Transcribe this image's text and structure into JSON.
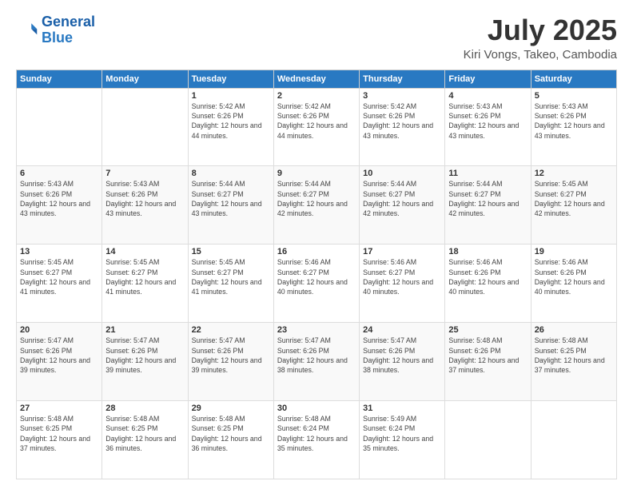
{
  "logo": {
    "line1": "General",
    "line2": "Blue"
  },
  "header": {
    "month_year": "July 2025",
    "location": "Kiri Vongs, Takeo, Cambodia"
  },
  "days_of_week": [
    "Sunday",
    "Monday",
    "Tuesday",
    "Wednesday",
    "Thursday",
    "Friday",
    "Saturday"
  ],
  "weeks": [
    [
      {
        "day": "",
        "info": ""
      },
      {
        "day": "",
        "info": ""
      },
      {
        "day": "1",
        "info": "Sunrise: 5:42 AM\nSunset: 6:26 PM\nDaylight: 12 hours and 44 minutes."
      },
      {
        "day": "2",
        "info": "Sunrise: 5:42 AM\nSunset: 6:26 PM\nDaylight: 12 hours and 44 minutes."
      },
      {
        "day": "3",
        "info": "Sunrise: 5:42 AM\nSunset: 6:26 PM\nDaylight: 12 hours and 43 minutes."
      },
      {
        "day": "4",
        "info": "Sunrise: 5:43 AM\nSunset: 6:26 PM\nDaylight: 12 hours and 43 minutes."
      },
      {
        "day": "5",
        "info": "Sunrise: 5:43 AM\nSunset: 6:26 PM\nDaylight: 12 hours and 43 minutes."
      }
    ],
    [
      {
        "day": "6",
        "info": "Sunrise: 5:43 AM\nSunset: 6:26 PM\nDaylight: 12 hours and 43 minutes."
      },
      {
        "day": "7",
        "info": "Sunrise: 5:43 AM\nSunset: 6:26 PM\nDaylight: 12 hours and 43 minutes."
      },
      {
        "day": "8",
        "info": "Sunrise: 5:44 AM\nSunset: 6:27 PM\nDaylight: 12 hours and 43 minutes."
      },
      {
        "day": "9",
        "info": "Sunrise: 5:44 AM\nSunset: 6:27 PM\nDaylight: 12 hours and 42 minutes."
      },
      {
        "day": "10",
        "info": "Sunrise: 5:44 AM\nSunset: 6:27 PM\nDaylight: 12 hours and 42 minutes."
      },
      {
        "day": "11",
        "info": "Sunrise: 5:44 AM\nSunset: 6:27 PM\nDaylight: 12 hours and 42 minutes."
      },
      {
        "day": "12",
        "info": "Sunrise: 5:45 AM\nSunset: 6:27 PM\nDaylight: 12 hours and 42 minutes."
      }
    ],
    [
      {
        "day": "13",
        "info": "Sunrise: 5:45 AM\nSunset: 6:27 PM\nDaylight: 12 hours and 41 minutes."
      },
      {
        "day": "14",
        "info": "Sunrise: 5:45 AM\nSunset: 6:27 PM\nDaylight: 12 hours and 41 minutes."
      },
      {
        "day": "15",
        "info": "Sunrise: 5:45 AM\nSunset: 6:27 PM\nDaylight: 12 hours and 41 minutes."
      },
      {
        "day": "16",
        "info": "Sunrise: 5:46 AM\nSunset: 6:27 PM\nDaylight: 12 hours and 40 minutes."
      },
      {
        "day": "17",
        "info": "Sunrise: 5:46 AM\nSunset: 6:27 PM\nDaylight: 12 hours and 40 minutes."
      },
      {
        "day": "18",
        "info": "Sunrise: 5:46 AM\nSunset: 6:26 PM\nDaylight: 12 hours and 40 minutes."
      },
      {
        "day": "19",
        "info": "Sunrise: 5:46 AM\nSunset: 6:26 PM\nDaylight: 12 hours and 40 minutes."
      }
    ],
    [
      {
        "day": "20",
        "info": "Sunrise: 5:47 AM\nSunset: 6:26 PM\nDaylight: 12 hours and 39 minutes."
      },
      {
        "day": "21",
        "info": "Sunrise: 5:47 AM\nSunset: 6:26 PM\nDaylight: 12 hours and 39 minutes."
      },
      {
        "day": "22",
        "info": "Sunrise: 5:47 AM\nSunset: 6:26 PM\nDaylight: 12 hours and 39 minutes."
      },
      {
        "day": "23",
        "info": "Sunrise: 5:47 AM\nSunset: 6:26 PM\nDaylight: 12 hours and 38 minutes."
      },
      {
        "day": "24",
        "info": "Sunrise: 5:47 AM\nSunset: 6:26 PM\nDaylight: 12 hours and 38 minutes."
      },
      {
        "day": "25",
        "info": "Sunrise: 5:48 AM\nSunset: 6:26 PM\nDaylight: 12 hours and 37 minutes."
      },
      {
        "day": "26",
        "info": "Sunrise: 5:48 AM\nSunset: 6:25 PM\nDaylight: 12 hours and 37 minutes."
      }
    ],
    [
      {
        "day": "27",
        "info": "Sunrise: 5:48 AM\nSunset: 6:25 PM\nDaylight: 12 hours and 37 minutes."
      },
      {
        "day": "28",
        "info": "Sunrise: 5:48 AM\nSunset: 6:25 PM\nDaylight: 12 hours and 36 minutes."
      },
      {
        "day": "29",
        "info": "Sunrise: 5:48 AM\nSunset: 6:25 PM\nDaylight: 12 hours and 36 minutes."
      },
      {
        "day": "30",
        "info": "Sunrise: 5:48 AM\nSunset: 6:24 PM\nDaylight: 12 hours and 35 minutes."
      },
      {
        "day": "31",
        "info": "Sunrise: 5:49 AM\nSunset: 6:24 PM\nDaylight: 12 hours and 35 minutes."
      },
      {
        "day": "",
        "info": ""
      },
      {
        "day": "",
        "info": ""
      }
    ]
  ]
}
